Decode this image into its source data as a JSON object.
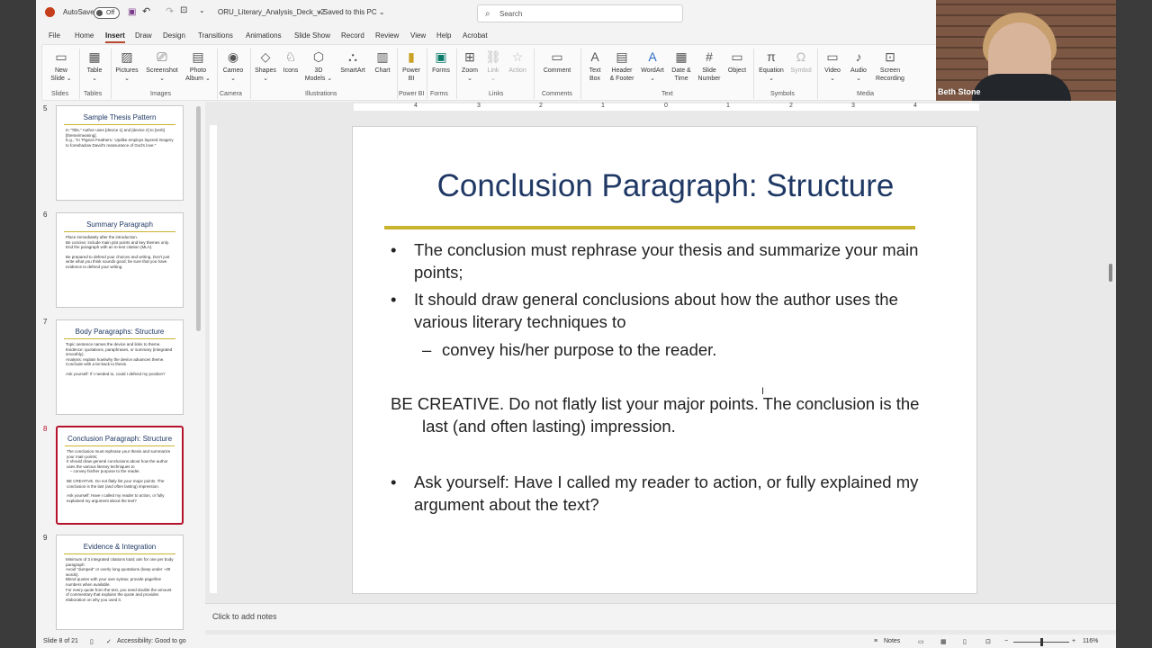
{
  "titlebar": {
    "autosave_label": "AutoSave",
    "autosave_state": "Off",
    "filename": "ORU_Literary_Analysis_Deck_v2",
    "save_status": "• Saved to this PC ⌄",
    "search_placeholder": "Search"
  },
  "menu_tabs": [
    "File",
    "Home",
    "Insert",
    "Draw",
    "Design",
    "Transitions",
    "Animations",
    "Slide Show",
    "Record",
    "Review",
    "View",
    "Help",
    "Acrobat"
  ],
  "ribbon": {
    "groups": [
      "Slides",
      "Tables",
      "Images",
      "Camera",
      "Illustrations",
      "Power BI",
      "Forms",
      "Links",
      "Comments",
      "Text",
      "Symbols",
      "Media"
    ],
    "buttons": {
      "new_slide": "New\nSlide ⌄",
      "table": "Table\n⌄",
      "pictures": "Pictures\n⌄",
      "screenshot": "Screenshot\n⌄",
      "photo_album": "Photo\nAlbum ⌄",
      "cameo": "Cameo\n⌄",
      "shapes": "Shapes\n⌄",
      "icons": "Icons",
      "models_3d": "3D\nModels ⌄",
      "smartart": "SmartArt",
      "chart": "Chart",
      "power_bi": "Power\nBI",
      "forms": "Forms",
      "zoom": "Zoom\n⌄",
      "link": "Link\n⌄",
      "action": "Action",
      "comment": "Comment",
      "text_box": "Text\nBox",
      "header_footer": "Header\n& Footer",
      "wordart": "WordArt\n⌄",
      "date_time": "Date &\nTime",
      "slide_number": "Slide\nNumber",
      "object": "Object",
      "equation": "Equation\n⌄",
      "symbol": "Symbol",
      "video": "Video\n⌄",
      "audio": "Audio\n⌄",
      "screen_recording": "Screen\nRecording"
    }
  },
  "thumbnails": [
    {
      "num": "5",
      "title": "Sample Thesis Pattern",
      "bullets": [
        "In \"Title,\" Author uses [device 1] and [device 2] to [verb] [theme/meaning].",
        "E.g., \"In 'Pigeon Feathers,' Updike employs layered imagery to foreshadow David's reassurance of God's love.\""
      ]
    },
    {
      "num": "6",
      "title": "Summary Paragraph",
      "bullets": [
        "Place immediately after the introduction.",
        "Be concise; include main plot points and key themes only.",
        "End the paragraph with an in-text citation (MLA).",
        "",
        "Be prepared to defend your choices and writing. Don't just write what you think sounds good; be sure that you have evidence to defend your writing."
      ]
    },
    {
      "num": "7",
      "title": "Body Paragraphs: Structure",
      "bullets": [
        "Topic sentence names the device and links to theme.",
        "Evidence: quotations, paraphrases, or summary (integrated smoothly).",
        "Analysis: explain how/why the device advances theme.",
        "Conclude with a tie-back to thesis.",
        "",
        "Ask yourself: If I needed to, could I defend my position?"
      ]
    },
    {
      "num": "8",
      "title": "Conclusion Paragraph: Structure",
      "bullets": [
        "The conclusion must rephrase your thesis and summarize your main points;",
        "It should draw general conclusions about how the author uses the various literary techniques to",
        "   – convey his/her purpose to the reader.",
        "",
        "BE CREATIVE. Do not flatly list your major points. The conclusion is the last (and often lasting) impression.",
        "",
        "Ask yourself: Have I called my reader to action, or fully explained my argument about the text?"
      ]
    },
    {
      "num": "9",
      "title": "Evidence & Integration",
      "bullets": [
        "Minimum of 3 integrated citations total; aim for one per body paragraph.",
        "Avoid \"dumped\" or overly long quotations (keep under ~30 words).",
        "Blend quotes with your own syntax; provide page/line numbers when available.",
        "For every quote from the text, you need double the amount of commentary that explains the quote and provides elaboration on why you used it."
      ]
    }
  ],
  "slide": {
    "title": "Conclusion Paragraph: Structure",
    "bullet1": "The conclusion must rephrase your thesis and summarize your main points;",
    "bullet2": "It should draw general conclusions about how the author uses the various literary techniques to",
    "sub_bullet": "convey his/her purpose to the reader.",
    "paragraph": "BE CREATIVE. Do not flatly list your major points. The conclusion is the last (and often lasting) impression.",
    "bullet3": "Ask yourself: Have I called my reader to action, or fully explained my argument about the text?"
  },
  "ruler_numbers": [
    "4",
    "3",
    "2",
    "1",
    "0",
    "1",
    "2",
    "3",
    "4"
  ],
  "notes_placeholder": "Click to add notes",
  "status": {
    "slide_count": "Slide 8 of 21",
    "accessibility": "Accessibility: Good to go",
    "notes": "Notes",
    "zoom": "116%"
  },
  "webcam_name": "Beth Stone",
  "colors": {
    "accent": "#b7472a",
    "title": "#1f3864",
    "rule": "#c9b32d",
    "selected": "#b4132c"
  }
}
